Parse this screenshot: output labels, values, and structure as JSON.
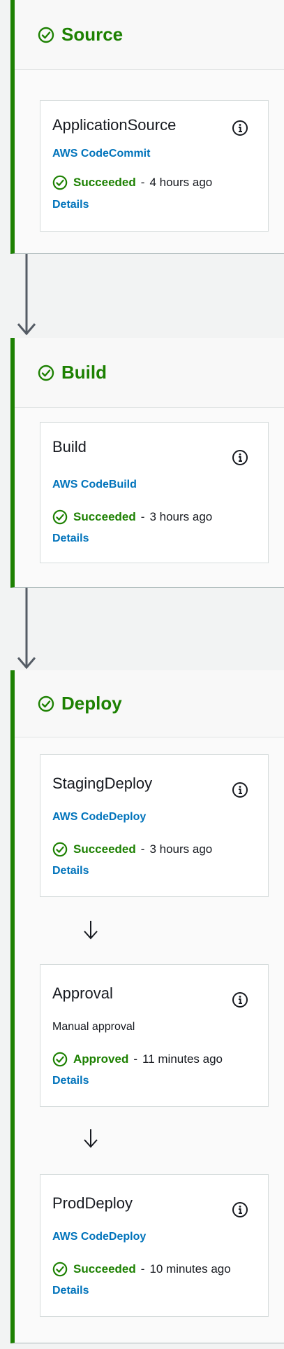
{
  "stages": [
    {
      "title": "Source",
      "actions": [
        {
          "name": "ApplicationSource",
          "provider": "AWS CodeCommit",
          "status": "Succeeded",
          "separator": "-",
          "time": "4 hours ago",
          "details": "Details"
        }
      ]
    },
    {
      "title": "Build",
      "actions": [
        {
          "name": "Build",
          "provider": "AWS CodeBuild",
          "status": "Succeeded",
          "separator": "-",
          "time": "3 hours ago",
          "details": "Details"
        }
      ]
    },
    {
      "title": "Deploy",
      "actions": [
        {
          "name": "StagingDeploy",
          "provider": "AWS CodeDeploy",
          "status": "Succeeded",
          "separator": "-",
          "time": "3 hours ago",
          "details": "Details"
        },
        {
          "name": "Approval",
          "subtitle": "Manual approval",
          "status": "Approved",
          "separator": "-",
          "time": "11 minutes ago",
          "details": "Details"
        },
        {
          "name": "ProdDeploy",
          "provider": "AWS CodeDeploy",
          "status": "Succeeded",
          "separator": "-",
          "time": "10 minutes ago",
          "details": "Details"
        }
      ]
    }
  ],
  "icons": {
    "stage_status": "check-circle-icon",
    "action_status": "check-circle-icon",
    "info": "info-icon",
    "transition": "arrow-down-icon"
  },
  "colors": {
    "success": "#1d8102",
    "link": "#0073bb",
    "stage_border": "#1d8102",
    "text": "#16191f",
    "connector": "#545b64"
  }
}
